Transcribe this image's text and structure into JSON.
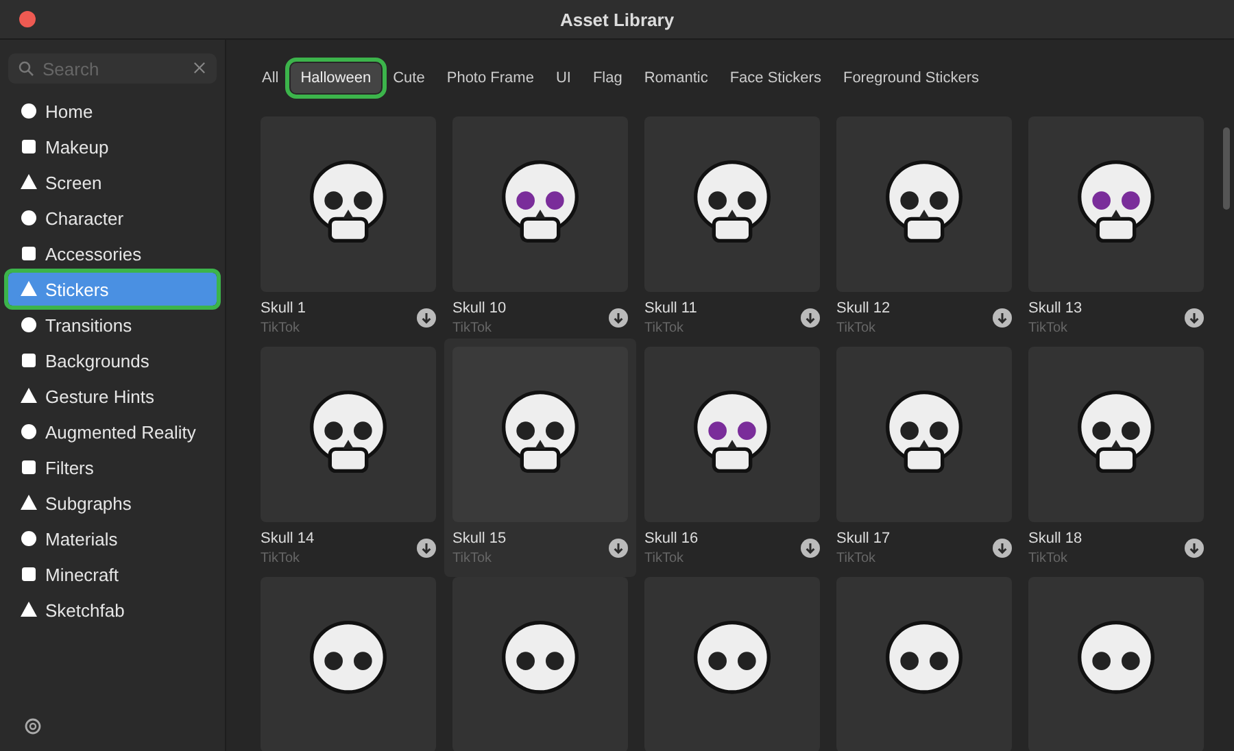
{
  "window": {
    "title": "Asset Library"
  },
  "search": {
    "placeholder": "Search"
  },
  "sidebar": {
    "items": [
      {
        "label": "Home",
        "selected": false,
        "highlighted": false
      },
      {
        "label": "Makeup",
        "selected": false,
        "highlighted": false
      },
      {
        "label": "Screen",
        "selected": false,
        "highlighted": false
      },
      {
        "label": "Character",
        "selected": false,
        "highlighted": false
      },
      {
        "label": "Accessories",
        "selected": false,
        "highlighted": false
      },
      {
        "label": "Stickers",
        "selected": true,
        "highlighted": true
      },
      {
        "label": "Transitions",
        "selected": false,
        "highlighted": false
      },
      {
        "label": "Backgrounds",
        "selected": false,
        "highlighted": false
      },
      {
        "label": "Gesture Hints",
        "selected": false,
        "highlighted": false
      },
      {
        "label": "Augmented Reality",
        "selected": false,
        "highlighted": false
      },
      {
        "label": "Filters",
        "selected": false,
        "highlighted": false
      },
      {
        "label": "Subgraphs",
        "selected": false,
        "highlighted": false
      },
      {
        "label": "Materials",
        "selected": false,
        "highlighted": false
      },
      {
        "label": "Minecraft",
        "selected": false,
        "highlighted": false
      },
      {
        "label": "Sketchfab",
        "selected": false,
        "highlighted": false
      }
    ]
  },
  "tabs": [
    {
      "label": "All",
      "selected": false,
      "highlighted": false
    },
    {
      "label": "Halloween",
      "selected": true,
      "highlighted": true
    },
    {
      "label": "Cute",
      "selected": false,
      "highlighted": false
    },
    {
      "label": "Photo Frame",
      "selected": false,
      "highlighted": false
    },
    {
      "label": "UI",
      "selected": false,
      "highlighted": false
    },
    {
      "label": "Flag",
      "selected": false,
      "highlighted": false
    },
    {
      "label": "Romantic",
      "selected": false,
      "highlighted": false
    },
    {
      "label": "Face Stickers",
      "selected": false,
      "highlighted": false
    },
    {
      "label": "Foreground Stickers",
      "selected": false,
      "highlighted": false
    }
  ],
  "assets": [
    {
      "name": "Skull 1",
      "source": "TikTok",
      "selected": false
    },
    {
      "name": "Skull 10",
      "source": "TikTok",
      "selected": false
    },
    {
      "name": "Skull 11",
      "source": "TikTok",
      "selected": false
    },
    {
      "name": "Skull 12",
      "source": "TikTok",
      "selected": false
    },
    {
      "name": "Skull 13",
      "source": "TikTok",
      "selected": false
    },
    {
      "name": "Skull 14",
      "source": "TikTok",
      "selected": false
    },
    {
      "name": "Skull 15",
      "source": "TikTok",
      "selected": true
    },
    {
      "name": "Skull 16",
      "source": "TikTok",
      "selected": false
    },
    {
      "name": "Skull 17",
      "source": "TikTok",
      "selected": false
    },
    {
      "name": "Skull 18",
      "source": "TikTok",
      "selected": false
    }
  ]
}
